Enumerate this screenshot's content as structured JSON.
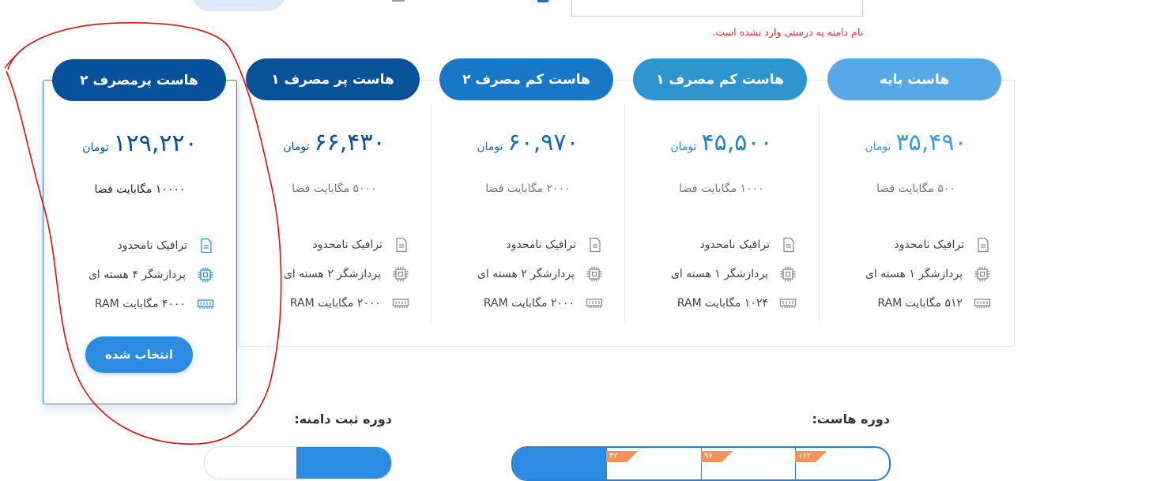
{
  "domain": {
    "error_message": "نام دامنه به درستی وارد نشده است."
  },
  "plans": [
    {
      "name": "هاست پایه",
      "header_color": "#56a8e6",
      "price": "۳۵,۴۹۰",
      "currency": "تومان",
      "space": "۵۰۰ مگابایت فضا",
      "traffic": "ترافیک نامحدود",
      "cpu": "پردازشگر ۱ هسته ای",
      "ram": "۵۱۲ مگابایت RAM"
    },
    {
      "name": "هاست کم مصرف ۱",
      "header_color": "#2f95cf",
      "price": "۴۵,۵۰۰",
      "currency": "تومان",
      "space": "۱۰۰۰ مگابایت فضا",
      "traffic": "ترافیک نامحدود",
      "cpu": "پردازشگر ۱ هسته ای",
      "ram": "۱۰۲۴ مگابایت RAM"
    },
    {
      "name": "هاست کم مصرف ۲",
      "header_color": "#1878c7",
      "price": "۶۰,۹۷۰",
      "currency": "تومان",
      "space": "۲۰۰۰ مگابایت فضا",
      "traffic": "ترافیک نامحدود",
      "cpu": "پردازشگر ۲ هسته ای",
      "ram": "۲۰۰۰ مگابایت RAM"
    },
    {
      "name": "هاست پر مصرف ۱",
      "header_color": "#0a5297",
      "price": "۶۶,۴۳۰",
      "currency": "تومان",
      "space": "۵۰۰۰ مگابایت فضا",
      "traffic": "ترافیک نامحدود",
      "cpu": "پردازشگر ۲ هسته ای",
      "ram": "۲۰۰۰ مگابایت RAM"
    },
    {
      "name": "هاست پرمصرف ۲",
      "header_color": "#07509a",
      "price": "۱۲۹,۲۲۰",
      "currency": "تومان",
      "space": "۱۰۰۰۰ مگابایت فضا",
      "traffic": "ترافیک نامحدود",
      "cpu": "پردازشگر ۴ هسته ای",
      "ram": "۴۰۰۰ مگابایت RAM",
      "selected": true,
      "button_label": "انتخاب شده"
    }
  ],
  "host_period": {
    "label": "دوره هاست:",
    "badges": [
      "۱۶۲",
      "۹۷",
      "۴۲"
    ]
  },
  "domain_period": {
    "label": "دوره ثبت دامنه:"
  },
  "colors": {
    "accent": "#2d8be0",
    "annotation": "#e01010",
    "badge": "#f0925a"
  }
}
